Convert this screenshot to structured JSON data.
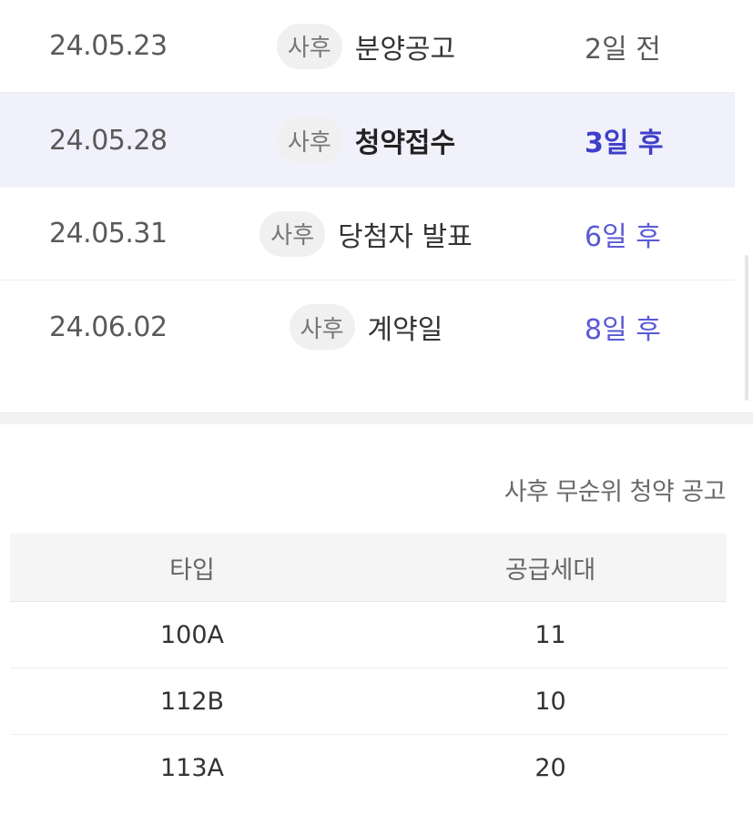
{
  "schedule": {
    "badge_text": "사후",
    "rows": [
      {
        "date": "24.05.23",
        "label": "분양공고",
        "dday": "2일 전"
      },
      {
        "date": "24.05.28",
        "label": "청약접수",
        "dday": "3일 후"
      },
      {
        "date": "24.05.31",
        "label": "당첨자 발표",
        "dday": "6일 후"
      },
      {
        "date": "24.06.02",
        "label": "계약일",
        "dday": "8일 후"
      }
    ]
  },
  "supply": {
    "title": "사후 무순위 청약 공고",
    "headers": {
      "type": "타입",
      "units": "공급세대"
    },
    "rows": [
      {
        "type": "100A",
        "units": "11"
      },
      {
        "type": "112B",
        "units": "10"
      },
      {
        "type": "113A",
        "units": "20"
      }
    ]
  },
  "colors": {
    "highlight_bg": "#f1f1fb",
    "future_dday": "#5a5ad6",
    "current_dday": "#3f3fc9"
  }
}
